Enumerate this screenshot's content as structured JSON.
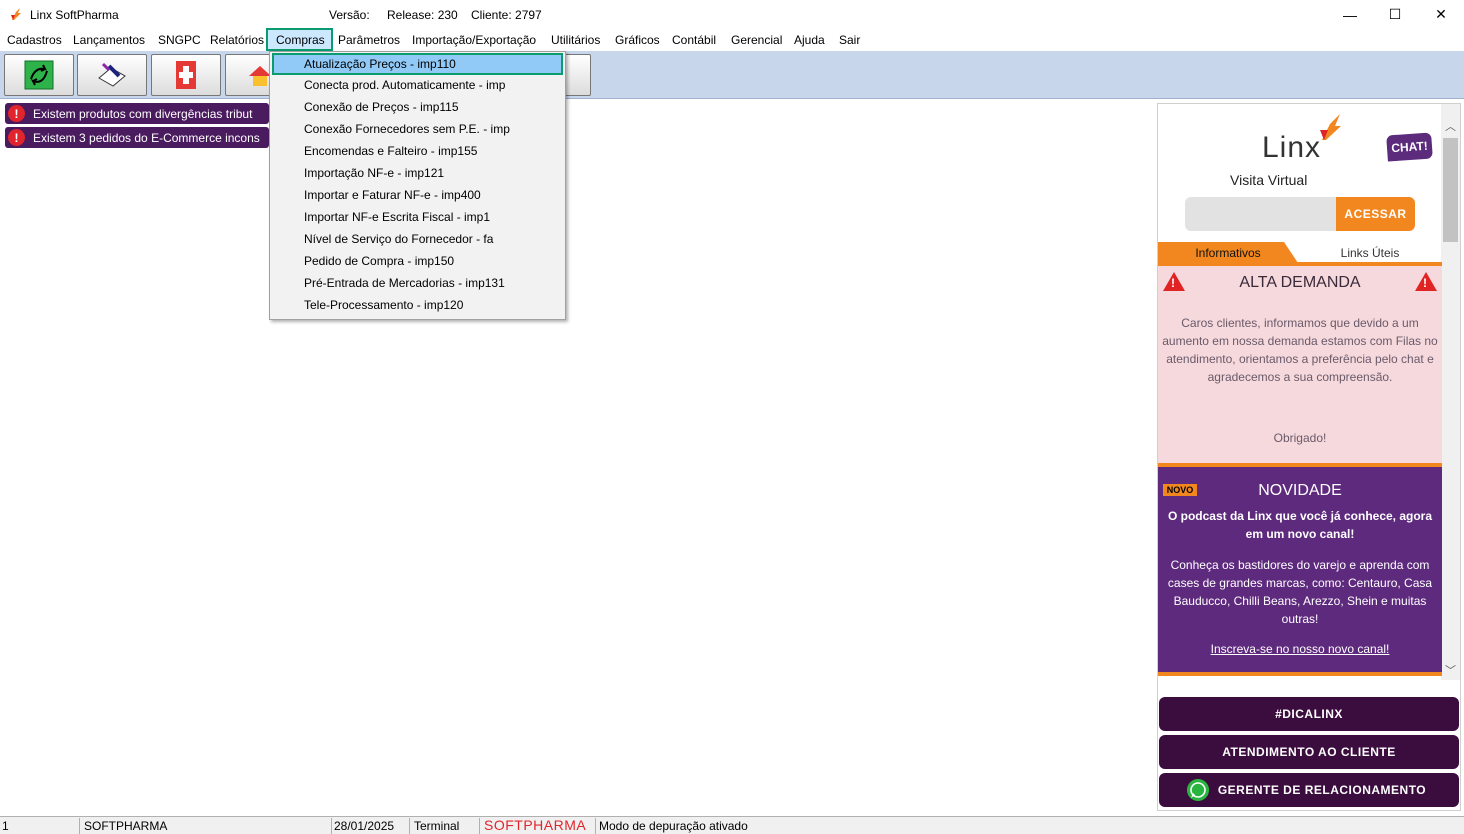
{
  "titlebar": {
    "app_title": "Linx SoftPharma",
    "versao_label": "Versão:",
    "release": "Release: 230",
    "cliente": "Cliente: 2797",
    "minimize": "—",
    "maximize": "☐",
    "close": "✕"
  },
  "menu": {
    "items": [
      "Cadastros",
      "Lançamentos",
      "SNGPC",
      "Relatórios",
      "Compras",
      "Parâmetros",
      "Importação/Exportação",
      "Utilitários",
      "Gráficos",
      "Contábil",
      "Gerencial",
      "Ajuda",
      "Sair"
    ]
  },
  "compras_menu": {
    "items": [
      "Atualização Preços - imp110",
      "Conecta prod. Automaticamente - imp",
      "Conexão de Preços - imp115",
      "Conexão Fornecedores sem P.E. - imp",
      "Encomendas e Falteiro - imp155",
      "Importação NF-e - imp121",
      "Importar e Faturar NF-e - imp400",
      "Importar NF-e Escrita Fiscal - imp1",
      "Nível de Serviço do Fornecedor - fa",
      "Pedido de Compra - imp150",
      "Pré-Entrada de Mercadorias - imp131",
      "Tele-Processamento - imp120"
    ]
  },
  "alerts": {
    "a1": "Existem produtos com divergências tribut",
    "a2": "Existem 3 pedidos do E-Commerce incons",
    "icon": "!"
  },
  "panel": {
    "logo": "Linx",
    "chat": "CHAT!",
    "visita": "Visita Virtual",
    "acessar": "ACESSAR",
    "tab_info": "Informativos",
    "tab_links": "Links Úteis",
    "alta_title": "ALTA DEMANDA",
    "alta_text": "Caros clientes, informamos que devido a um aumento em nossa demanda estamos com Filas no atendimento, orientamos a preferência pelo chat e agradecemos a sua compreensão.",
    "alta_thanks": "Obrigado!",
    "warn_mark": "!",
    "novo_badge": "NOVO",
    "nov_title": "NOVIDADE",
    "nov_sub": "O podcast da Linx que você já conhece, agora em um novo canal!",
    "nov_text": "Conheça os bastidores do varejo e aprenda com cases de grandes marcas, como: Centauro, Casa Bauducco, Chilli Beans, Arezzo, Shein e muitas outras!",
    "nov_link": "Inscreva-se no nosso novo canal!",
    "btn_dica": "#DICALINX",
    "btn_atend": "ATENDIMENTO AO CLIENTE",
    "btn_gerente": "GERENTE DE RELACIONAMENTO",
    "scroll_up": "︿",
    "scroll_down": "﹀"
  },
  "status": {
    "s1": "1",
    "s2": "SOFTPHARMA",
    "s3": "28/01/2025",
    "s4": "Terminal",
    "s5": "SOFTPHARMA",
    "s6": "Modo de depuração ativado"
  },
  "colors": {
    "accent_orange": "#f2871f",
    "purple": "#5e2a7e",
    "highlight_green": "#0a9b6f",
    "alert_red": "#e0252c"
  }
}
